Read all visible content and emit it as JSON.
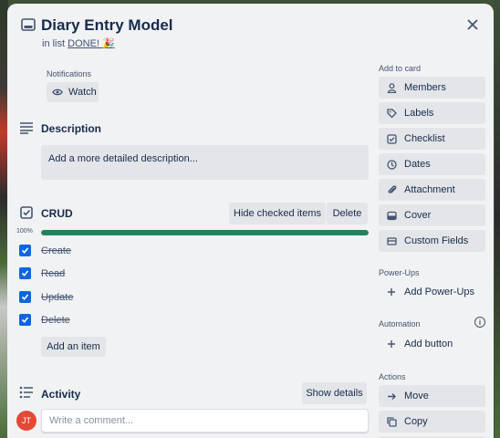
{
  "card": {
    "title": "Diary Entry Model",
    "list_prefix": "in list",
    "list_name": "DONE! 🎉"
  },
  "notifications": {
    "label": "Notifications",
    "watch_label": "Watch"
  },
  "description": {
    "heading": "Description",
    "placeholder": "Add a more detailed description..."
  },
  "checklist": {
    "heading": "CRUD",
    "hide_checked_label": "Hide checked items",
    "delete_label": "Delete",
    "progress_label": "100%",
    "progress": 1.0,
    "items": [
      {
        "text": "Create",
        "checked": true
      },
      {
        "text": "Read",
        "checked": true
      },
      {
        "text": "Update",
        "checked": true
      },
      {
        "text": "Delete",
        "checked": true
      }
    ],
    "add_item_label": "Add an item"
  },
  "activity": {
    "heading": "Activity",
    "show_details_label": "Show details",
    "avatar_initials": "JT",
    "comment_placeholder": "Write a comment..."
  },
  "sidebar": {
    "add_to_card_label": "Add to card",
    "add_to_card": [
      {
        "label": "Members",
        "icon": "person-icon"
      },
      {
        "label": "Labels",
        "icon": "tag-icon"
      },
      {
        "label": "Checklist",
        "icon": "checklist-icon"
      },
      {
        "label": "Dates",
        "icon": "clock-icon"
      },
      {
        "label": "Attachment",
        "icon": "paperclip-icon"
      },
      {
        "label": "Cover",
        "icon": "cover-icon"
      },
      {
        "label": "Custom Fields",
        "icon": "custom-fields-icon"
      }
    ],
    "powerups_label": "Power-Ups",
    "add_powerups_label": "Add Power-Ups",
    "automation_label": "Automation",
    "add_button_label": "Add button",
    "actions_label": "Actions",
    "actions": [
      {
        "label": "Move",
        "icon": "arrow-right-icon"
      },
      {
        "label": "Copy",
        "icon": "copy-icon"
      }
    ]
  },
  "colors": {
    "accent_blue": "#0c66e4",
    "progress_green": "#1f845a",
    "avatar_red": "#e34935",
    "panel_bg": "#f1f2f4",
    "button_bg": "#e3e5e8"
  }
}
